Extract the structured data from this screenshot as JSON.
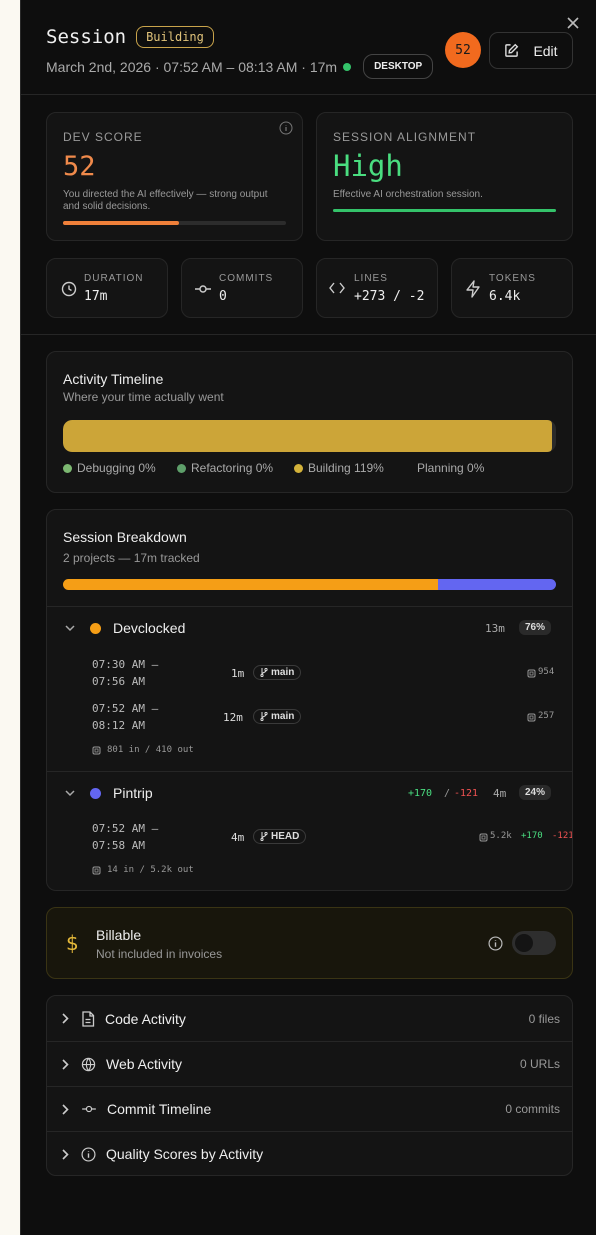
{
  "header": {
    "title": "Session",
    "status": "Building",
    "datetime": "March 2nd, 2026 · 07:52 AM – 08:13 AM · 17m",
    "platform": "DESKTOP",
    "score_badge": "52",
    "edit_label": "Edit"
  },
  "dev_score": {
    "label": "DEV SCORE",
    "value": "52",
    "description": "You directed the AI effectively — strong output and solid decisions.",
    "progress": 0.52
  },
  "alignment": {
    "label": "SESSION ALIGNMENT",
    "value": "High",
    "description": "Effective AI orchestration session.",
    "progress": 1.0
  },
  "stats": [
    {
      "label": "DURATION",
      "value": "17m",
      "icon": "clock-icon"
    },
    {
      "label": "COMMITS",
      "value": "0",
      "icon": "commit-icon"
    },
    {
      "label": "LINES",
      "value": "+273 / -2",
      "icon": "code-icon"
    },
    {
      "label": "TOKENS",
      "value": "6.4k",
      "icon": "lightning-icon"
    }
  ],
  "timeline": {
    "title": "Activity Timeline",
    "subtitle": "Where your time actually went",
    "legend": [
      {
        "label": "Debugging 0%",
        "color": "#7cb871"
      },
      {
        "label": "Refactoring 0%",
        "color": "#5e9f6a"
      },
      {
        "label": "Building 119%",
        "color": "#d3b23a"
      },
      {
        "label": "Planning 0%",
        "color": ""
      }
    ]
  },
  "breakdown": {
    "title": "Session Breakdown",
    "subtitle": "2 projects — 17m tracked",
    "projects": [
      {
        "name": "Devclocked",
        "color": "#f59e16",
        "lines_added": "",
        "lines_removed": "",
        "duration": "13m",
        "percent": "76%",
        "share": 0.76,
        "sessions": [
          {
            "time_start": "07:30 AM –",
            "time_end": "07:56 AM",
            "duration": "1m",
            "branch": "main",
            "tokens": "954"
          },
          {
            "time_start": "07:52 AM –",
            "time_end": "08:12 AM",
            "duration": "12m",
            "branch": "main",
            "tokens": "257"
          }
        ],
        "io": "801 in / 410 out"
      },
      {
        "name": "Pintrip",
        "color": "#6366f1",
        "lines_added": "+170",
        "lines_removed": "-121",
        "duration": "4m",
        "percent": "24%",
        "share": 0.24,
        "sessions": [
          {
            "time_start": "07:52 AM –",
            "time_end": "07:58 AM",
            "duration": "4m",
            "branch": "HEAD",
            "tokens": "5.2k",
            "added": "+170",
            "removed": "-121"
          }
        ],
        "io": "14 in / 5.2k out"
      }
    ]
  },
  "billable": {
    "title": "Billable",
    "subtitle": "Not included in invoices",
    "enabled": false
  },
  "accordions": [
    {
      "label": "Code Activity",
      "count": "0 files",
      "icon": "file-icon"
    },
    {
      "label": "Web Activity",
      "count": "0 URLs",
      "icon": "globe-icon"
    },
    {
      "label": "Commit Timeline",
      "count": "0 commits",
      "icon": "commit-icon"
    },
    {
      "label": "Quality Scores by Activity",
      "count": "",
      "icon": "info-icon"
    }
  ]
}
